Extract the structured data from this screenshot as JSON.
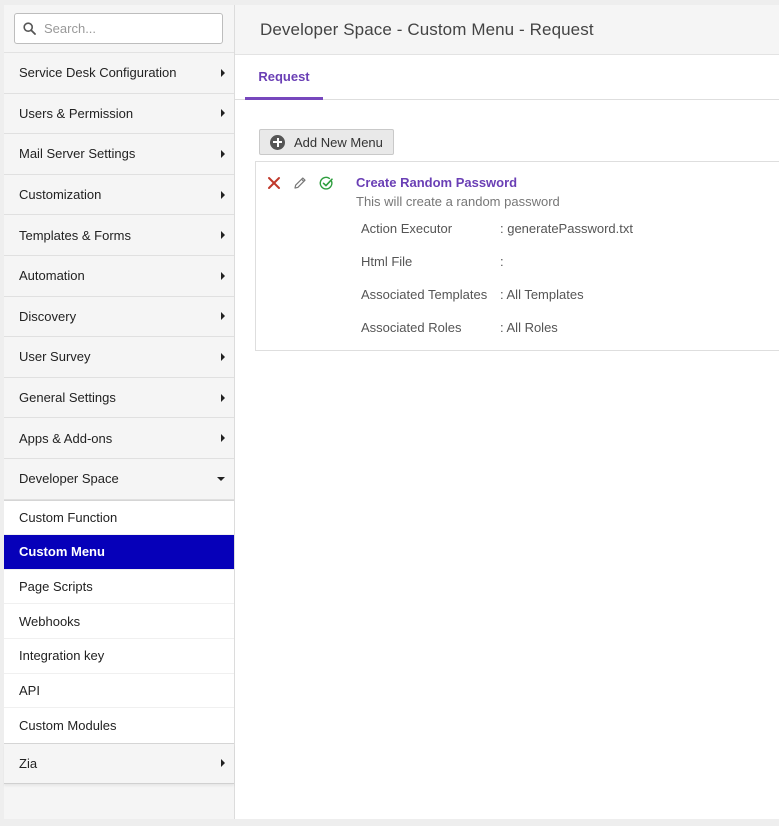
{
  "search": {
    "placeholder": "Search..."
  },
  "sidebar": {
    "items": [
      {
        "label": "Service Desk Configuration",
        "name": "sidebar-item-service-desk-configuration"
      },
      {
        "label": "Users & Permission",
        "name": "sidebar-item-users-permission"
      },
      {
        "label": "Mail Server Settings",
        "name": "sidebar-item-mail-server-settings"
      },
      {
        "label": "Customization",
        "name": "sidebar-item-customization"
      },
      {
        "label": "Templates & Forms",
        "name": "sidebar-item-templates-forms"
      },
      {
        "label": "Automation",
        "name": "sidebar-item-automation"
      },
      {
        "label": "Discovery",
        "name": "sidebar-item-discovery"
      },
      {
        "label": "User Survey",
        "name": "sidebar-item-user-survey"
      },
      {
        "label": "General Settings",
        "name": "sidebar-item-general-settings"
      },
      {
        "label": "Apps & Add-ons",
        "name": "sidebar-item-apps-addons"
      }
    ],
    "expanded": {
      "label": "Developer Space",
      "children": [
        {
          "label": "Custom Function",
          "active": false
        },
        {
          "label": "Custom Menu",
          "active": true
        },
        {
          "label": "Page Scripts",
          "active": false
        },
        {
          "label": "Webhooks",
          "active": false
        },
        {
          "label": "Integration key",
          "active": false
        },
        {
          "label": "API",
          "active": false
        },
        {
          "label": "Custom Modules",
          "active": false
        }
      ]
    },
    "last": {
      "label": "Zia"
    }
  },
  "header": {
    "title": "Developer Space - Custom Menu - Request"
  },
  "tabs": [
    {
      "label": "Request",
      "active": true
    }
  ],
  "toolbar": {
    "add_label": "Add New Menu"
  },
  "menu_entry": {
    "title": "Create Random Password",
    "description": "This will create a random password",
    "properties": [
      {
        "label": "Action Executor",
        "value": ": generatePassword.txt"
      },
      {
        "label": "Html File",
        "value": ":"
      },
      {
        "label": "Associated Templates",
        "value": ": All Templates"
      },
      {
        "label": "Associated Roles",
        "value": ": All Roles"
      }
    ]
  },
  "icons": {
    "search": "search-icon",
    "delete": "close-icon",
    "edit": "pencil-icon",
    "enabled": "check-circle-icon",
    "add": "plus-circle-icon"
  },
  "colors": {
    "accent": "#6a3fb5",
    "active_nav": "#0600b9",
    "delete": "#c0392b",
    "enabled": "#2e9e3e"
  }
}
